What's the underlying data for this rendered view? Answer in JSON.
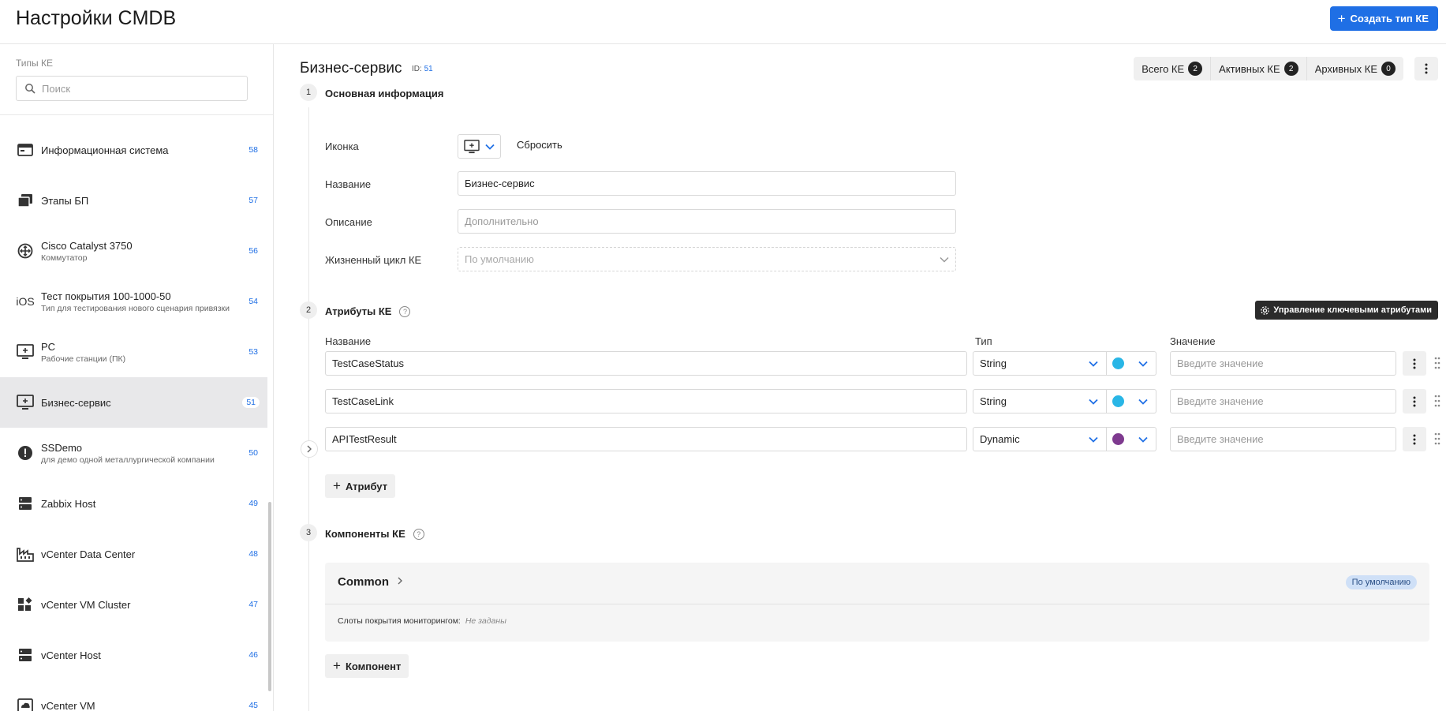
{
  "header": {
    "title": "Настройки CMDB",
    "create_label": "Создать тип КЕ"
  },
  "sidebar": {
    "heading": "Типы КЕ",
    "search_placeholder": "Поиск",
    "items": [
      {
        "name": "Информационная система",
        "sub": "",
        "id": "58",
        "icon": "window-icon"
      },
      {
        "name": "Этапы БП",
        "sub": "",
        "id": "57",
        "icon": "stacked-pages-icon"
      },
      {
        "name": "Cisco Catalyst 3750",
        "sub": "Коммутатор",
        "id": "56",
        "icon": "switch-icon"
      },
      {
        "name": "Тест покрытия 100-1000-50",
        "sub": "Тип для тестирования нового сценария привязки",
        "id": "54",
        "icon": "ios-icon"
      },
      {
        "name": "PC",
        "sub": "Рабочие станции (ПК)",
        "id": "53",
        "icon": "monitor-icon"
      },
      {
        "name": "Бизнес-сервис",
        "sub": "",
        "id": "51",
        "icon": "monitor-icon",
        "active": true
      },
      {
        "name": "SSDemo",
        "sub": "для демо одной металлургической компании",
        "id": "50",
        "icon": "alert-icon"
      },
      {
        "name": "Zabbix Host",
        "sub": "",
        "id": "49",
        "icon": "server-icon"
      },
      {
        "name": "vCenter Data Center",
        "sub": "",
        "id": "48",
        "icon": "factory-icon"
      },
      {
        "name": "vCenter VM Cluster",
        "sub": "",
        "id": "47",
        "icon": "widgets-icon"
      },
      {
        "name": "vCenter Host",
        "sub": "",
        "id": "46",
        "icon": "server-icon"
      },
      {
        "name": "vCenter VM",
        "sub": "",
        "id": "45",
        "icon": "cloud-box-icon"
      }
    ]
  },
  "page": {
    "title": "Бизнес-сервис",
    "id_prefix": "ID:",
    "id_value": "51",
    "counters": [
      {
        "label": "Всего КЕ",
        "value": "2"
      },
      {
        "label": "Активных КЕ",
        "value": "2"
      },
      {
        "label": "Архивных КЕ",
        "value": "0"
      }
    ]
  },
  "basic": {
    "step": "1",
    "title": "Основная информация",
    "icon_label": "Иконка",
    "reset_label": "Сбросить",
    "name_label": "Название",
    "name_value": "Бизнес-сервис",
    "desc_label": "Описание",
    "desc_placeholder": "Дополнительно",
    "lifecycle_label": "Жизненный цикл КЕ",
    "lifecycle_value": "По умолчанию"
  },
  "attributes": {
    "step": "2",
    "title": "Атрибуты КЕ",
    "key_attrs_label": "Управление ключевыми атрибутами",
    "col_name": "Название",
    "col_type": "Тип",
    "col_value": "Значение",
    "value_placeholder": "Введите значение",
    "rows": [
      {
        "name": "TestCaseStatus",
        "type": "String",
        "color": "#29b6e6"
      },
      {
        "name": "TestCaseLink",
        "type": "String",
        "color": "#29b6e6"
      },
      {
        "name": "APITestResult",
        "type": "Dynamic",
        "color": "#7e3a8f"
      }
    ],
    "add_label": "Атрибут"
  },
  "components": {
    "step": "3",
    "title": "Компоненты КЕ",
    "card_name": "Common",
    "card_badge": "По умолчанию",
    "slots_label": "Слоты покрытия мониторингом:",
    "slots_value": "Не заданы",
    "add_label": "Компонент"
  }
}
